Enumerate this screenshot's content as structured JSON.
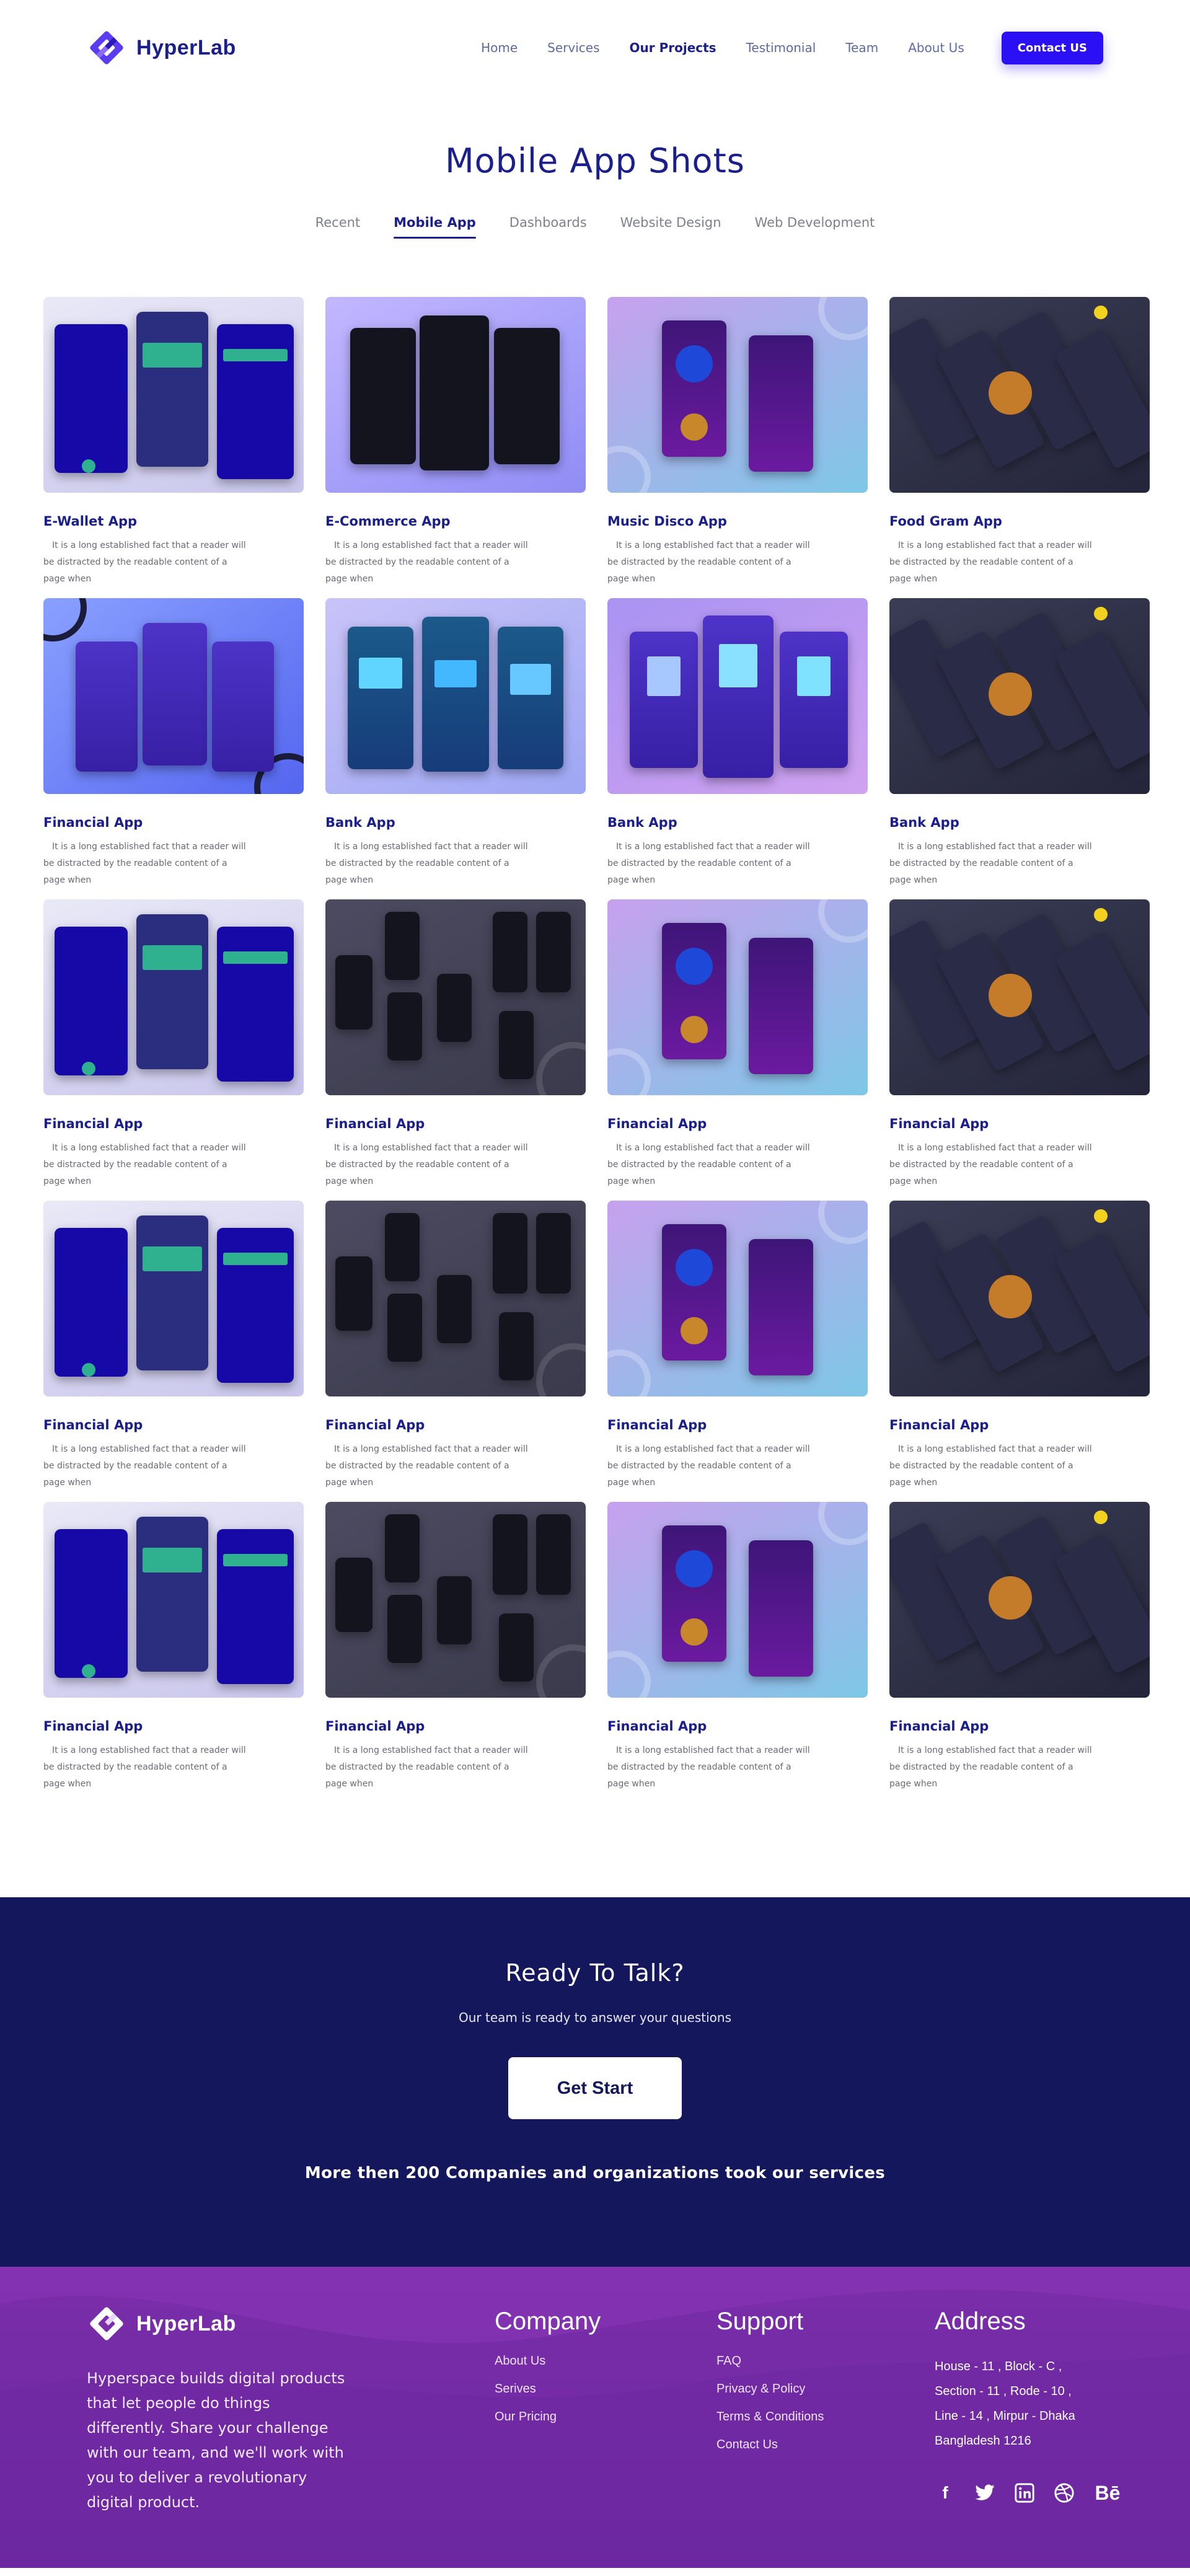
{
  "brand": {
    "name": "HyperLab"
  },
  "nav": {
    "links": [
      "Home",
      "Services",
      "Our Projects",
      "Testimonial",
      "Team",
      "About Us"
    ],
    "active": "Our Projects",
    "contact_label": "Contact US"
  },
  "portfolio": {
    "title": "Mobile App Shots",
    "tabs": [
      "Recent",
      "Mobile App",
      "Dashboards",
      "Website Design",
      "Web Development"
    ],
    "active_tab": "Mobile App",
    "description": "It is a long established fact that a reader will be distracted by the readable content of a page when",
    "projects": [
      {
        "title": "E-Wallet App",
        "theme": "ewallet"
      },
      {
        "title": "E-Commerce App",
        "theme": "ecom"
      },
      {
        "title": "Music Disco App",
        "theme": "disco"
      },
      {
        "title": "Food Gram App",
        "theme": "food"
      },
      {
        "title": "Financial App",
        "theme": "fin-blue"
      },
      {
        "title": "Bank App",
        "theme": "bank"
      },
      {
        "title": "Bank App",
        "theme": "bank2"
      },
      {
        "title": "Bank App",
        "theme": "food"
      },
      {
        "title": "Financial App",
        "theme": "ewallet"
      },
      {
        "title": "Financial App",
        "theme": "avalon"
      },
      {
        "title": "Financial App",
        "theme": "disco"
      },
      {
        "title": "Financial App",
        "theme": "food"
      },
      {
        "title": "Financial App",
        "theme": "ewallet"
      },
      {
        "title": "Financial App",
        "theme": "avalon"
      },
      {
        "title": "Financial App",
        "theme": "disco"
      },
      {
        "title": "Financial App",
        "theme": "food"
      },
      {
        "title": "Financial App",
        "theme": "ewallet"
      },
      {
        "title": "Financial App",
        "theme": "avalon"
      },
      {
        "title": "Financial App",
        "theme": "disco"
      },
      {
        "title": "Financial App",
        "theme": "food"
      }
    ]
  },
  "cta": {
    "title": "Ready To Talk?",
    "subtitle": "Our team is ready to answer your questions",
    "button_label": "Get Start",
    "note": "More then 200 Companies and organizations took our services"
  },
  "footer": {
    "brand_name": "HyperLab",
    "about": "Hyperspace builds digital products that let people do things differently. Share your challenge with our team, and we'll work with you to deliver a revolutionary digital product.",
    "company": {
      "heading": "Company",
      "links": [
        "About Us",
        "Serives",
        "Our Pricing"
      ]
    },
    "support": {
      "heading": "Support",
      "links": [
        "FAQ",
        "Privacy & Policy",
        "Terms & Conditions",
        "Contact Us"
      ]
    },
    "address": {
      "heading": "Address",
      "text": "House - 11 , Block - C , Section - 11 , Rode - 10 , Line - 14 , Mirpur - Dhaka Bangladesh 1216"
    },
    "socials": [
      "facebook-icon",
      "twitter-icon",
      "linkedin-icon",
      "dribbble-icon",
      "behance-icon"
    ]
  },
  "colors": {
    "primary": "#1b1f8c",
    "accent": "#2b10f5",
    "cta_bg": "#15175d",
    "footer_bg": "#7b2ea9"
  }
}
